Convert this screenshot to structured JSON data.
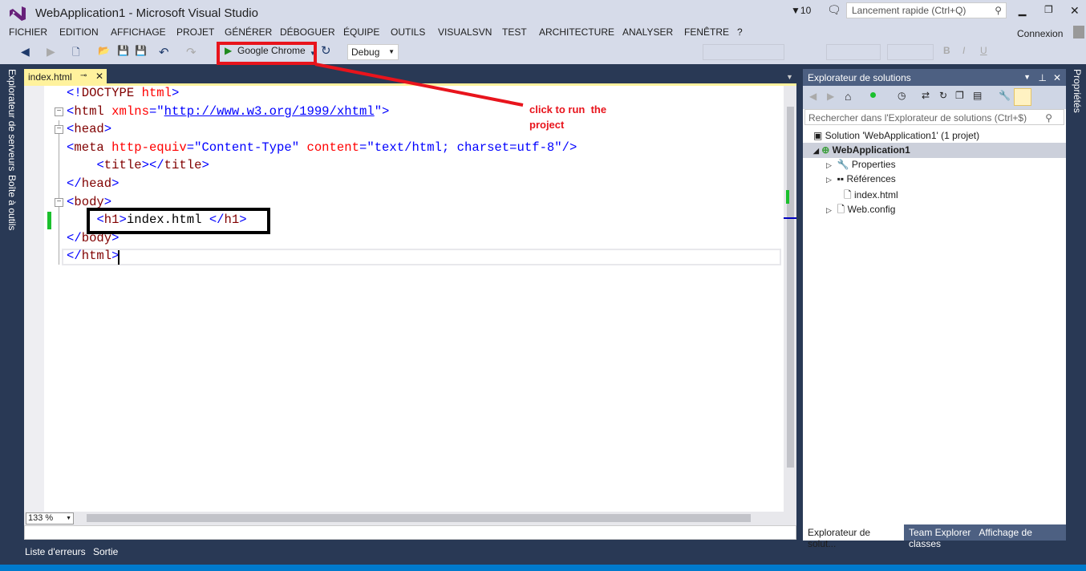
{
  "window": {
    "title": "WebApplication1 - Microsoft Visual Studio",
    "notifications": "10",
    "quick_launch_placeholder": "Lancement rapide (Ctrl+Q)",
    "signin": "Connexion"
  },
  "menu": [
    "FICHIER",
    "EDITION",
    "AFFICHAGE",
    "PROJET",
    "GÉNÉRER",
    "DÉBOGUER",
    "ÉQUIPE",
    "OUTILS",
    "VISUALSVN",
    "TEST",
    "ARCHITECTURE",
    "ANALYSER",
    "FENÊTRE",
    "?"
  ],
  "toolbar": {
    "run_target": "Google Chrome",
    "configuration": "Debug"
  },
  "left_tabs": [
    "Explorateur de serveurs",
    "Boîte à outils"
  ],
  "right_tabs": [
    "Propriétés"
  ],
  "editor": {
    "tab": "index.html",
    "zoom": "133 %",
    "lines": [
      [
        [
          "tg",
          "<!"
        ],
        [
          "el",
          "DOCTYPE"
        ],
        [
          "tx",
          " "
        ],
        [
          "at",
          "html"
        ],
        [
          "tg",
          ">"
        ]
      ],
      [
        [
          "tg",
          "<"
        ],
        [
          "el",
          "html"
        ],
        [
          "tx",
          " "
        ],
        [
          "at",
          "xmlns"
        ],
        [
          "tg",
          "=\""
        ],
        [
          "lk",
          "http://www.w3.org/1999/xhtml"
        ],
        [
          "tg",
          "\">"
        ]
      ],
      [
        [
          "tg",
          "<"
        ],
        [
          "el",
          "head"
        ],
        [
          "tg",
          ">"
        ]
      ],
      [
        [
          "tg",
          "<"
        ],
        [
          "el",
          "meta"
        ],
        [
          "tx",
          " "
        ],
        [
          "at",
          "http-equiv"
        ],
        [
          "tg",
          "=\"Content-Type\""
        ],
        [
          "tx",
          " "
        ],
        [
          "at",
          "content"
        ],
        [
          "tg",
          "=\"text/html; charset=utf-8\"/>"
        ]
      ],
      [
        [
          "tx",
          "    "
        ],
        [
          "tg",
          "<"
        ],
        [
          "el",
          "title"
        ],
        [
          "tg",
          "></"
        ],
        [
          "el",
          "title"
        ],
        [
          "tg",
          ">"
        ]
      ],
      [
        [
          "tg",
          "</"
        ],
        [
          "el",
          "head"
        ],
        [
          "tg",
          ">"
        ]
      ],
      [
        [
          "tg",
          "<"
        ],
        [
          "el",
          "body"
        ],
        [
          "tg",
          ">"
        ]
      ],
      [
        [
          "tx",
          "    "
        ],
        [
          "tg",
          "<"
        ],
        [
          "el",
          "h1"
        ],
        [
          "tg",
          ">"
        ],
        [
          "tx",
          "index.html "
        ],
        [
          "tg",
          "</"
        ],
        [
          "el",
          "h1"
        ],
        [
          "tg",
          ">"
        ]
      ],
      [
        [
          "tg",
          "</"
        ],
        [
          "el",
          "body"
        ],
        [
          "tg",
          ">"
        ]
      ],
      [
        [
          "tg",
          "</"
        ],
        [
          "el",
          "html"
        ],
        [
          "tg",
          ">"
        ]
      ]
    ]
  },
  "annotation": {
    "text_line1": "click to run  the",
    "text_line2": "project",
    "color": "#e8141c"
  },
  "solution_explorer": {
    "title": "Explorateur de solutions",
    "search_placeholder": "Rechercher dans l'Explorateur de solutions (Ctrl+$)",
    "items": [
      {
        "label": "Solution 'WebApplication1' (1 projet)"
      },
      {
        "label": "WebApplication1"
      },
      {
        "label": "Properties"
      },
      {
        "label": "Références"
      },
      {
        "label": "index.html"
      },
      {
        "label": "Web.config"
      }
    ],
    "tabs": [
      "Explorateur de solut...",
      "Team Explorer",
      "Affichage de classes"
    ]
  },
  "bottom_tabs": [
    "Liste d'erreurs",
    "Sortie"
  ],
  "colors": {
    "accent": "#007acc",
    "chrome": "#293955",
    "light": "#d6dbe9"
  }
}
